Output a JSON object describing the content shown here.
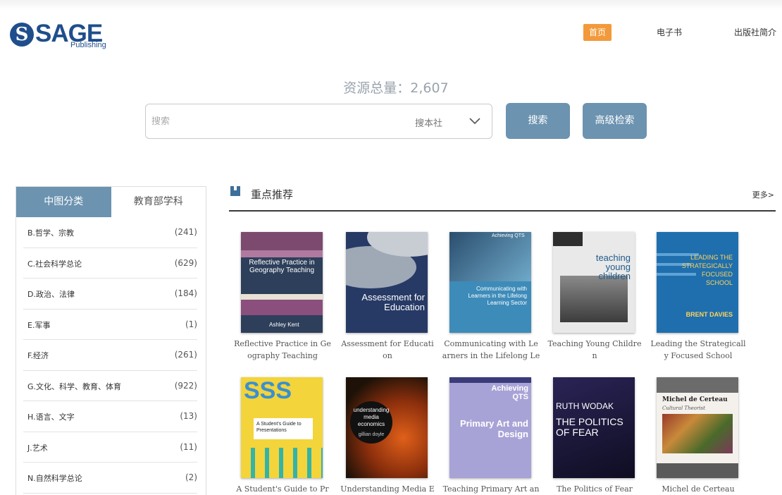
{
  "header": {
    "logo_word": "SAGE",
    "logo_sub": "Publishing",
    "nav": [
      {
        "label": "首页"
      },
      {
        "label": "电子书"
      },
      {
        "label": "出版社简介"
      }
    ]
  },
  "search": {
    "total_label": "资源总量：",
    "total_value": "2,607",
    "placeholder": "搜索",
    "scope": "搜本社",
    "search_button": "搜索",
    "advanced_button": "高级检索"
  },
  "categories": {
    "tabs": [
      "中图分类",
      "教育部学科"
    ],
    "items": [
      {
        "name": "B.哲学、宗教",
        "count": "(241)"
      },
      {
        "name": "C.社会科学总论",
        "count": "(629)"
      },
      {
        "name": "D.政治、法律",
        "count": "(184)"
      },
      {
        "name": "E.军事",
        "count": "(1)"
      },
      {
        "name": "F.经济",
        "count": "(261)"
      },
      {
        "name": "G.文化、科学、教育、体育",
        "count": "(922)"
      },
      {
        "name": "H.语言、文字",
        "count": "(13)"
      },
      {
        "name": "J.艺术",
        "count": "(11)"
      },
      {
        "name": "N.自然科学总论",
        "count": "(2)"
      }
    ]
  },
  "recommend": {
    "title": "重点推荐",
    "more": "更多>",
    "books": [
      {
        "title_line1": "Reflective Practice in Ge",
        "title_line2": "ography Teaching",
        "cover_text1": "Reflective Practice in Geography Teaching",
        "cover_text2": "Ashley Kent"
      },
      {
        "title_line1": "Assessment for Educati",
        "title_line2": "on",
        "cover_text1": "Assessment for Education",
        "cover_text2": ""
      },
      {
        "title_line1": "Communicating with Le",
        "title_line2": "arners in the Lifelong Le",
        "cover_text1": "Achieving QTS",
        "cover_text2": "Communicating with Learners in the Lifelong Learning Sector"
      },
      {
        "title_line1": "Teaching Young Childre",
        "title_line2": "n",
        "cover_text1": "teaching young children",
        "cover_text2": ""
      },
      {
        "title_line1": "Leading the Strategicall",
        "title_line2": "y Focused School",
        "cover_text1": "LEADING THE STRATEGICALLY FOCUSED SCHOOL",
        "cover_text2": "BRENT DAVIES"
      },
      {
        "title_line1": "A Student's Guide to Pr",
        "title_line2": "",
        "cover_text1": "A Student's Guide to Presentations",
        "cover_text2": "SSS"
      },
      {
        "title_line1": "Understanding Media E",
        "title_line2": "",
        "cover_text1": "understanding media economics",
        "cover_text2": "gillian doyle"
      },
      {
        "title_line1": "Teaching Primary Art an",
        "title_line2": "",
        "cover_text1": "Achieving QTS",
        "cover_text2": "Primary Art and Design"
      },
      {
        "title_line1": "The Politics of Fear",
        "title_line2": "",
        "cover_text1": "RUTH WODAK",
        "cover_text2": "THE POLITICS OF FEAR"
      },
      {
        "title_line1": "Michel de Certeau",
        "title_line2": "",
        "cover_text1": "Michel de Certeau",
        "cover_text2": "Cultural Theorist"
      }
    ]
  },
  "colors": {
    "accent": "#6c93b0",
    "home_highlight": "#f29a3b",
    "brand": "#1f4e8c"
  }
}
